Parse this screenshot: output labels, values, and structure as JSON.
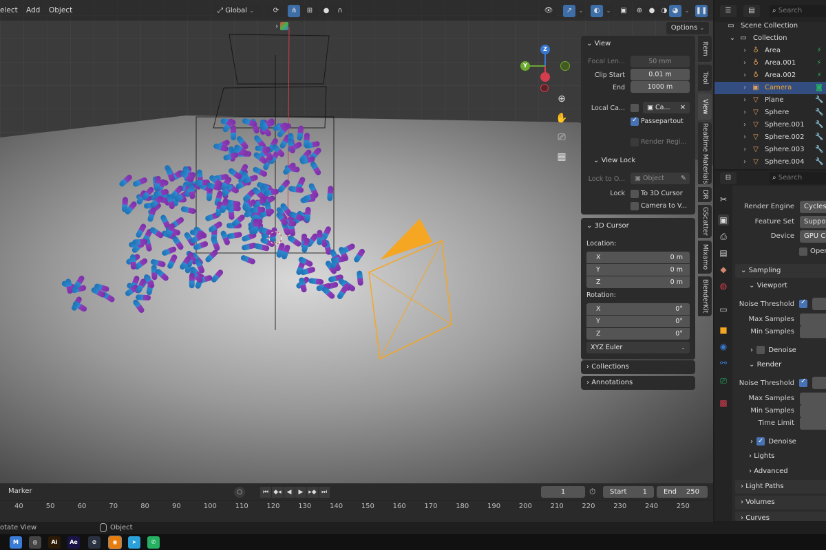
{
  "menu": {
    "select": "elect",
    "add": "Add",
    "object": "Object"
  },
  "header": {
    "transform_orientation": "Global",
    "options_label": "Options"
  },
  "icons": {
    "search": "search-icon",
    "gear": "gear-icon",
    "camera": "camera-icon",
    "light": "light-icon",
    "mesh": "mesh-icon",
    "wrench": "wrench-icon"
  },
  "colors": {
    "accent": "#4772b3",
    "selection": "#334d80",
    "camera_selected": "#f5a623",
    "axis_x": "#d43d4d",
    "axis_y": "#6ba82f",
    "axis_z": "#3878d1"
  },
  "n_panel": {
    "view_header": "View",
    "focal_label": "Focal Len...",
    "focal_value": "50 mm",
    "clip_start_label": "Clip Start",
    "clip_start_value": "0.01 m",
    "end_label": "End",
    "end_value": "1000 m",
    "local_camera_label": "Local Ca...",
    "local_camera_value": "Ca...",
    "passepartout_label": "Passepartout",
    "render_region_label": "Render Regi...",
    "view_lock_header": "View Lock",
    "lock_to_label": "Lock to O...",
    "lock_to_value": "Object",
    "lock_label": "Lock",
    "to_cursor_label": "To 3D Cursor",
    "camera_to_view_label": "Camera to V...",
    "cursor_header": "3D Cursor",
    "location_label": "Location:",
    "location": [
      {
        "axis": "X",
        "value": "0 m"
      },
      {
        "axis": "Y",
        "value": "0 m"
      },
      {
        "axis": "Z",
        "value": "0 m"
      }
    ],
    "rotation_label": "Rotation:",
    "rotation": [
      {
        "axis": "X",
        "value": "0°"
      },
      {
        "axis": "Y",
        "value": "0°"
      },
      {
        "axis": "Z",
        "value": "0°"
      }
    ],
    "rotation_mode": "XYZ Euler",
    "collections_header": "Collections",
    "annotations_header": "Annotations"
  },
  "vertical_tabs": [
    "Item",
    "Tool",
    "View",
    "Realtime Materials",
    "DR",
    "GScatter",
    "Mixamo",
    "BlenderKit"
  ],
  "outliner": {
    "search_placeholder": "Search",
    "scene_collection": "Scene Collection",
    "collection": "Collection",
    "items": [
      {
        "name": "Area",
        "type": "light"
      },
      {
        "name": "Area.001",
        "type": "light"
      },
      {
        "name": "Area.002",
        "type": "light"
      },
      {
        "name": "Camera",
        "type": "camera"
      },
      {
        "name": "Plane",
        "type": "mesh"
      },
      {
        "name": "Sphere",
        "type": "mesh"
      },
      {
        "name": "Sphere.001",
        "type": "mesh"
      },
      {
        "name": "Sphere.002",
        "type": "mesh"
      },
      {
        "name": "Sphere.003",
        "type": "mesh"
      },
      {
        "name": "Sphere.004",
        "type": "mesh"
      }
    ]
  },
  "properties": {
    "search_placeholder": "Search",
    "render_engine_label": "Render Engine",
    "render_engine_value": "Cycles",
    "feature_set_label": "Feature Set",
    "feature_set_value": "Suppor",
    "device_label": "Device",
    "device_value": "GPU Co",
    "open_label": "Open",
    "sampling_header": "Sampling",
    "viewport_header": "Viewport",
    "noise_threshold_label": "Noise Threshold",
    "max_samples_label": "Max Samples",
    "min_samples_label": "Min Samples",
    "denoise_label": "Denoise",
    "render_header": "Render",
    "render_noise_label": "Noise Threshold",
    "render_max_label": "Max Samples",
    "render_min_label": "Min Samples",
    "time_limit_label": "Time Limit",
    "render_denoise_label": "Denoise",
    "lights_header": "Lights",
    "advanced_header": "Advanced",
    "light_paths_header": "Light Paths",
    "volumes_header": "Volumes",
    "curves_header": "Curves"
  },
  "timeline": {
    "marker_label": "Marker",
    "current_frame": "1",
    "start_label": "Start",
    "start_value": "1",
    "end_label": "End",
    "end_value": "250",
    "ruler": [
      "40",
      "50",
      "60",
      "70",
      "80",
      "90",
      "100",
      "110",
      "120",
      "130",
      "140",
      "150",
      "160",
      "170",
      "180",
      "190",
      "200",
      "210",
      "220",
      "230",
      "240",
      "250"
    ]
  },
  "status": {
    "left": "otate View",
    "mid": "Object"
  },
  "taskbar": [
    {
      "label": "M",
      "color": "#3a7bd5"
    },
    {
      "label": "◎",
      "color": "#444444"
    },
    {
      "label": "Ai",
      "color": "#2b1a05"
    },
    {
      "label": "Ae",
      "color": "#1a1446"
    },
    {
      "label": "⊘",
      "color": "#2a3140"
    },
    {
      "label": "◉",
      "color": "#e87d0d"
    },
    {
      "label": "➤",
      "color": "#2aa1da"
    },
    {
      "label": "✆",
      "color": "#25b062"
    }
  ]
}
